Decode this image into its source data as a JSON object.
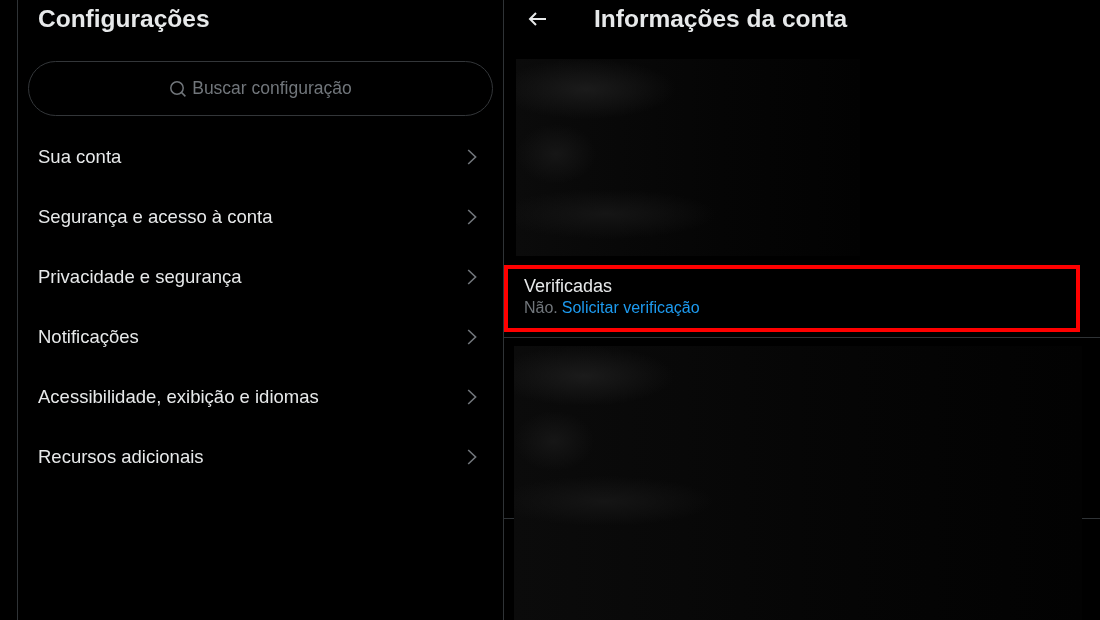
{
  "sidebar": {
    "title": "Configurações",
    "search": {
      "placeholder": "Buscar configuração"
    },
    "items": [
      {
        "label": "Sua conta"
      },
      {
        "label": "Segurança e acesso à conta"
      },
      {
        "label": "Privacidade e segurança"
      },
      {
        "label": "Notificações"
      },
      {
        "label": "Acessibilidade, exibição e idiomas"
      },
      {
        "label": "Recursos adicionais"
      }
    ]
  },
  "detail": {
    "title": "Informações da conta",
    "rows": [
      {
        "kind": "redacted"
      },
      {
        "kind": "field",
        "label": "Verificadas",
        "value": "Não.",
        "link": "Solicitar verificação",
        "highlighted": true
      },
      {
        "kind": "redacted"
      }
    ]
  }
}
